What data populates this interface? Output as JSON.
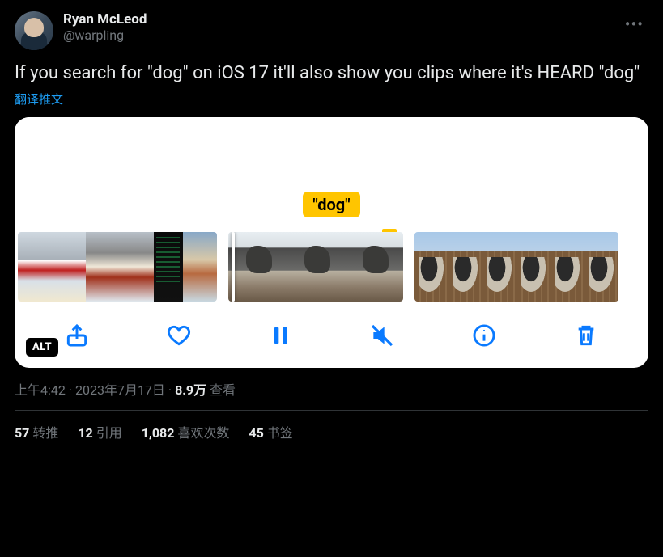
{
  "author": {
    "display_name": "Ryan McLeod",
    "handle": "@warpling"
  },
  "tweet_text": "If you search for \"dog\" on iOS 17 it'll also show you clips where it's HEARD \"dog\"",
  "translate_label": "翻译推文",
  "media": {
    "caption_label": "\"dog\"",
    "alt_badge": "ALT"
  },
  "meta": {
    "time": "上午4:42",
    "date": "2023年7月17日",
    "views_count": "8.9万",
    "views_label": "查看"
  },
  "stats": {
    "retweets": {
      "count": "57",
      "label": "转推"
    },
    "quotes": {
      "count": "12",
      "label": "引用"
    },
    "likes": {
      "count": "1,082",
      "label": "喜欢次数"
    },
    "bookmarks": {
      "count": "45",
      "label": "书签"
    }
  }
}
